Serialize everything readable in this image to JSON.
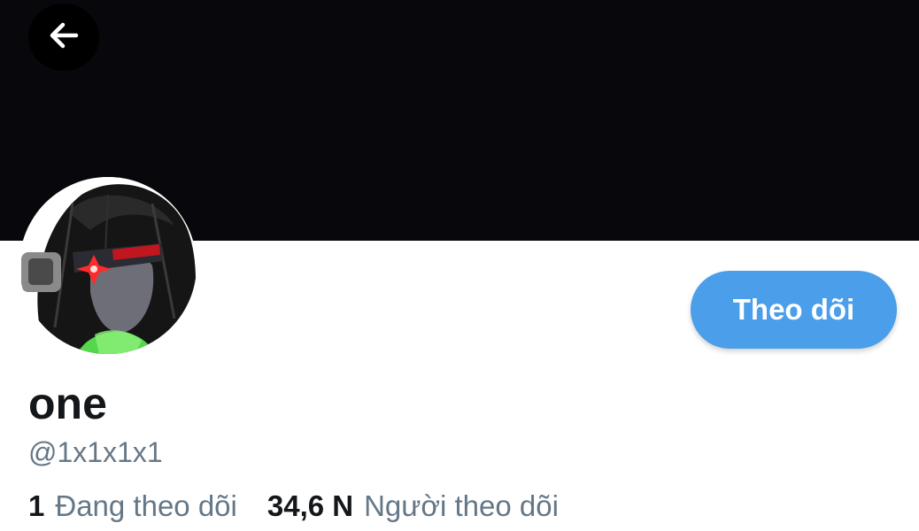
{
  "header": {
    "back_icon": "arrow-left-icon",
    "banner_color": "#07070c"
  },
  "profile": {
    "display_name": "one",
    "handle": "@1x1x1x1",
    "follow_button_label": "Theo dõi",
    "accent_color": "#4b9ee9"
  },
  "stats": {
    "following_count": "1",
    "following_label": "Đang theo dõi",
    "followers_count": "34,6 N",
    "followers_label": "Người theo dõi"
  }
}
